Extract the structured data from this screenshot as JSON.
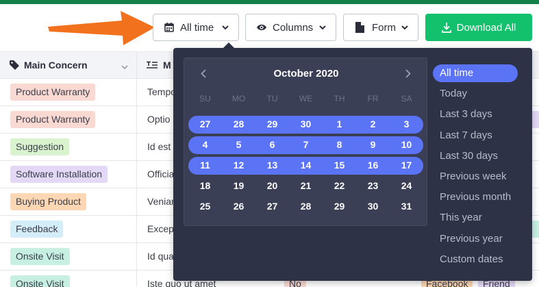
{
  "toolbar": {
    "time_label": "All time",
    "columns_label": "Columns",
    "form_label": "Form",
    "download_label": "Download All"
  },
  "table": {
    "headers": {
      "concern": "Main Concern",
      "message": "M"
    },
    "rows": [
      {
        "concern": "Product Warranty",
        "color": "#fbd9d3",
        "message": "Tempo"
      },
      {
        "concern": "Product Warranty",
        "color": "#fbd9d3",
        "message": "Optio"
      },
      {
        "concern": "Suggestion",
        "color": "#d9f3cf",
        "message": "Id est"
      },
      {
        "concern": "Software Installation",
        "color": "#e4d8f7",
        "message": "Officia"
      },
      {
        "concern": "Buying Product",
        "color": "#fdd7b3",
        "message": "Venian"
      },
      {
        "concern": "Feedback",
        "color": "#d3edf9",
        "message": "Excep"
      },
      {
        "concern": "Onsite Visit",
        "color": "#c7f0e3",
        "message": "Id qua"
      },
      {
        "concern": "Onsite Visit",
        "color": "#c7f0e3",
        "message": "Iste quo ut amet"
      }
    ],
    "tail": {
      "answer": "No",
      "source": "Facebook",
      "referral": "Friend"
    }
  },
  "calendar": {
    "month_title": "October 2020",
    "weekdays": [
      "SU",
      "MO",
      "TU",
      "WE",
      "TH",
      "FR",
      "SA"
    ],
    "weeks": [
      [
        "27",
        "28",
        "29",
        "30",
        "1",
        "2",
        "3"
      ],
      [
        "4",
        "5",
        "6",
        "7",
        "8",
        "9",
        "10"
      ],
      [
        "11",
        "12",
        "13",
        "14",
        "15",
        "16",
        "17"
      ],
      [
        "18",
        "19",
        "20",
        "21",
        "22",
        "23",
        "24"
      ],
      [
        "25",
        "26",
        "27",
        "28",
        "29",
        "30",
        "31"
      ]
    ],
    "highlighted_weeks": 3
  },
  "ranges": [
    {
      "label": "All time",
      "active": true
    },
    {
      "label": "Today",
      "active": false
    },
    {
      "label": "Last 3 days",
      "active": false
    },
    {
      "label": "Last 7 days",
      "active": false
    },
    {
      "label": "Last 30 days",
      "active": false
    },
    {
      "label": "Previous week",
      "active": false
    },
    {
      "label": "Previous month",
      "active": false
    },
    {
      "label": "This year",
      "active": false
    },
    {
      "label": "Previous year",
      "active": false
    },
    {
      "label": "Custom dates",
      "active": false
    }
  ],
  "colors": {
    "accent": "#5b73f5",
    "download": "#13c16c",
    "popup": "#2d3246",
    "annotation_arrow": "#f2711c"
  },
  "icons": {
    "time": "calendar-icon",
    "columns": "eye-icon",
    "form": "document-icon",
    "download": "download-icon"
  }
}
